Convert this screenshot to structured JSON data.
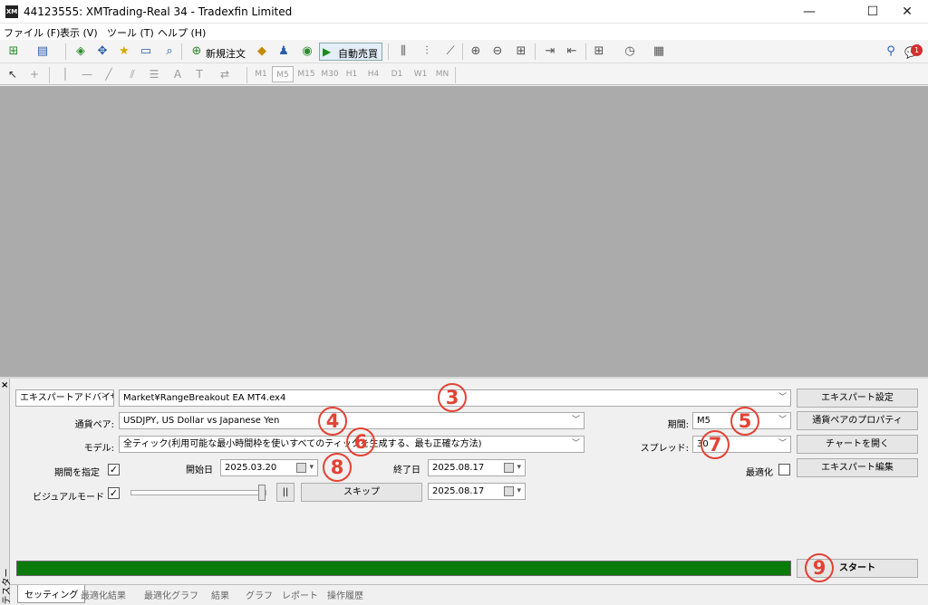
{
  "window": {
    "title": "44123555: XMTrading-Real 34 - Tradexfin Limited",
    "logo": "XM",
    "minimize": "—",
    "maximize": "☐",
    "close": "✕"
  },
  "menu": [
    "ファイル (F)",
    "表示 (V)",
    "ツール (T)",
    "ヘルプ (H)"
  ],
  "toolbar": {
    "new_order": "新規注文",
    "auto_trade": "自動売買",
    "notification_count": "1"
  },
  "timeframes": [
    "M1",
    "M5",
    "M15",
    "M30",
    "H1",
    "H4",
    "D1",
    "W1",
    "MN"
  ],
  "tester": {
    "side_label": "テスター",
    "close": "×",
    "mode_select": "エキスパートアドバイザ",
    "expert_file": "Market¥RangeBreakout EA MT4.ex4",
    "symbol_label": "通貨ペア:",
    "symbol_value": "USDJPY, US Dollar vs Japanese Yen",
    "model_label": "モデル:",
    "model_value": "全ティック(利用可能な最小時間枠を使いすべてのティックを生成する、最も正確な方法)",
    "period_label": "期間:",
    "period_value": "M5",
    "spread_label": "スプレッド:",
    "spread_value": "30",
    "use_date_label": "期間を指定",
    "use_date_checked": true,
    "start_label": "開始日",
    "start_date": "2025.03.20",
    "end_label": "終了日",
    "end_date": "2025.08.17",
    "visual_label": "ビジュアルモード",
    "visual_checked": true,
    "pause_label": "||",
    "skip_label": "スキップ",
    "skip_date": "2025.08.17",
    "optimize_label": "最適化",
    "optimize_checked": false,
    "btn_expert_settings": "エキスパート設定",
    "btn_symbol_properties": "通貨ペアのプロパティ",
    "btn_open_chart": "チャートを開く",
    "btn_edit_expert": "エキスパート編集",
    "btn_start": "スタート",
    "progress": 1.0,
    "progress_color": "#0a7a0a",
    "annotation_color": "#e34234"
  },
  "annotations": [
    "3",
    "4",
    "5",
    "6",
    "7",
    "8",
    "9"
  ],
  "tabs": [
    "セッティング",
    "最適化結果",
    "最適化グラフ",
    "結果",
    "グラフ",
    "レポート",
    "操作履歴"
  ]
}
